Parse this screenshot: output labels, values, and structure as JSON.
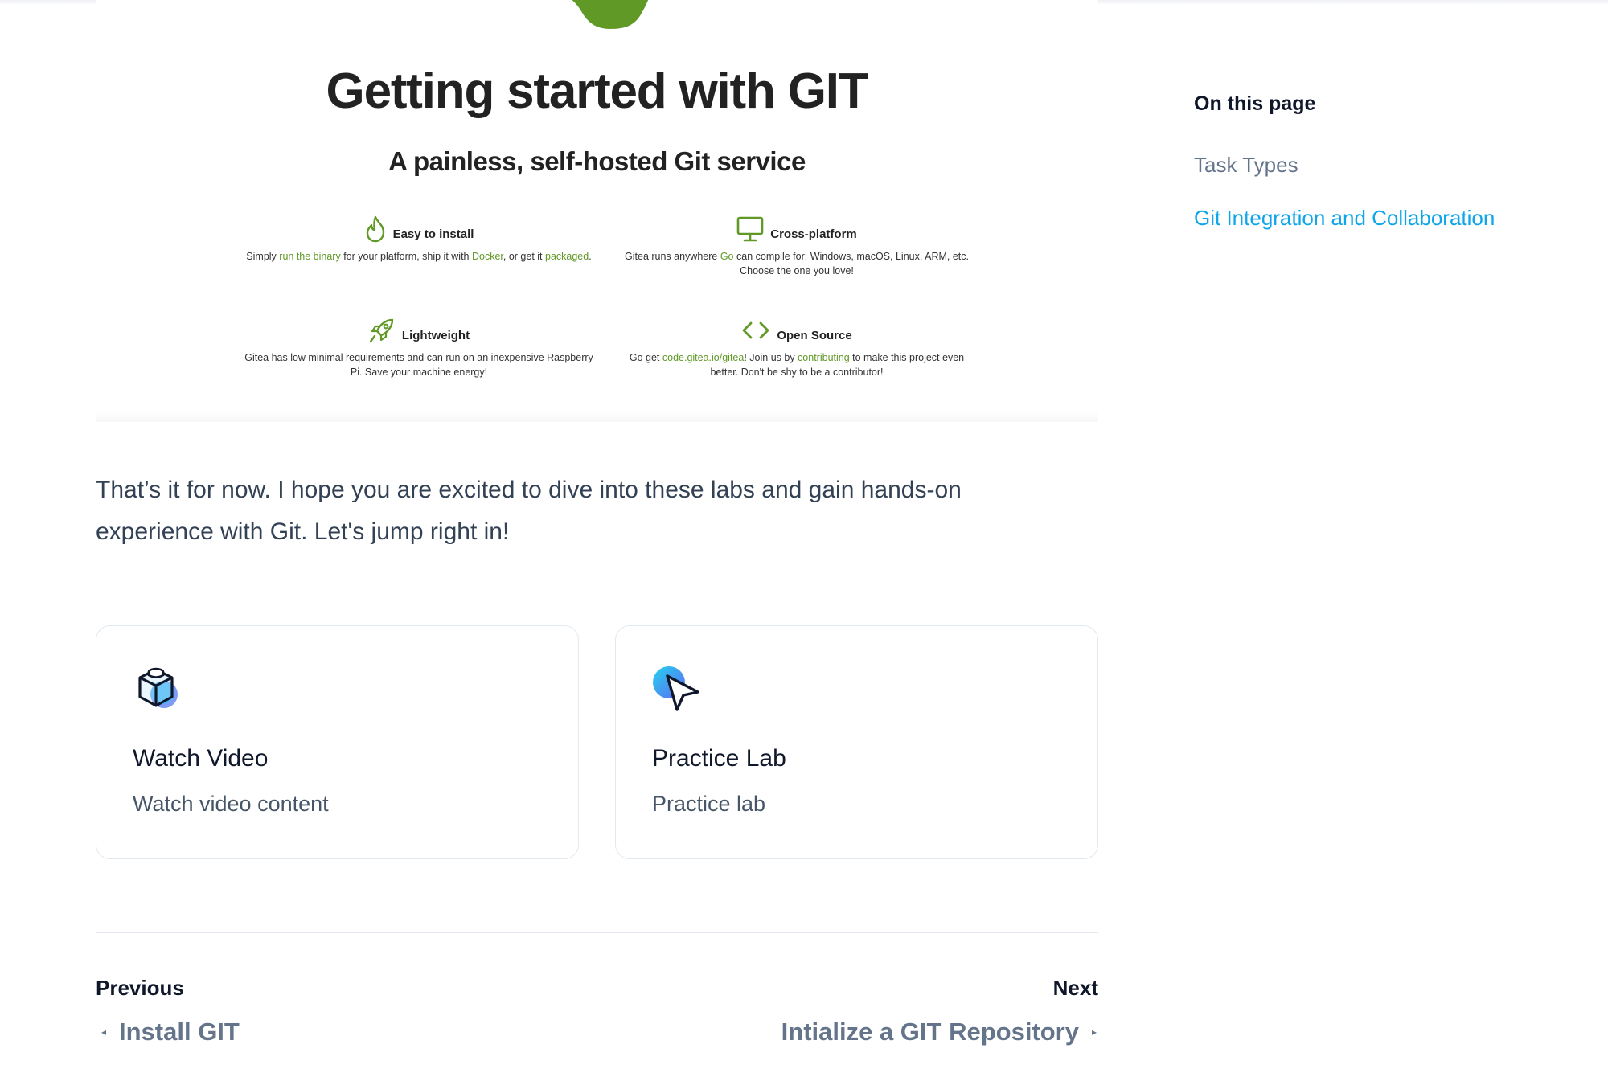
{
  "hero": {
    "title": "Getting started with GIT",
    "subtitle": "A painless, self-hosted Git service",
    "features": [
      {
        "title": "Easy to install",
        "icon": "flame-icon",
        "parts": [
          "Simply ",
          "run the binary",
          " for your platform, ship it with ",
          "Docker",
          ", or get it ",
          "packaged",
          "."
        ]
      },
      {
        "title": "Cross-platform",
        "icon": "monitor-icon",
        "parts": [
          "Gitea runs anywhere ",
          "Go",
          " can compile for: Windows, macOS, Linux, ARM, etc. Choose the one you love!"
        ]
      },
      {
        "title": "Lightweight",
        "icon": "rocket-icon",
        "parts": [
          "Gitea has low minimal requirements and can run on an inexpensive Raspberry Pi. Save your machine energy!"
        ]
      },
      {
        "title": "Open Source",
        "icon": "code-icon",
        "parts": [
          "Go get ",
          "code.gitea.io/gitea",
          "! Join us by ",
          "contributing",
          " to make this project even better. Don't be shy to be a contributor!"
        ]
      }
    ]
  },
  "intro": "That’s it for now. I hope you are excited to dive into these labs and gain hands-on experience with Git. Let's jump right in!",
  "cards": [
    {
      "title": "Watch Video",
      "description": "Watch video content",
      "icon": "cube-icon"
    },
    {
      "title": "Practice Lab",
      "description": "Practice lab",
      "icon": "cursor-icon"
    }
  ],
  "pager": {
    "prev_label": "Previous",
    "prev_link": "Install GIT",
    "next_label": "Next",
    "next_link": "Intialize a GIT Repository"
  },
  "toc": {
    "title": "On this page",
    "items": [
      "Task Types",
      "Git Integration and Collaboration"
    ],
    "active_color": "#0ea5e9"
  },
  "colors": {
    "gitea_green": "#609926",
    "link_blue": "#0ea5e9"
  }
}
